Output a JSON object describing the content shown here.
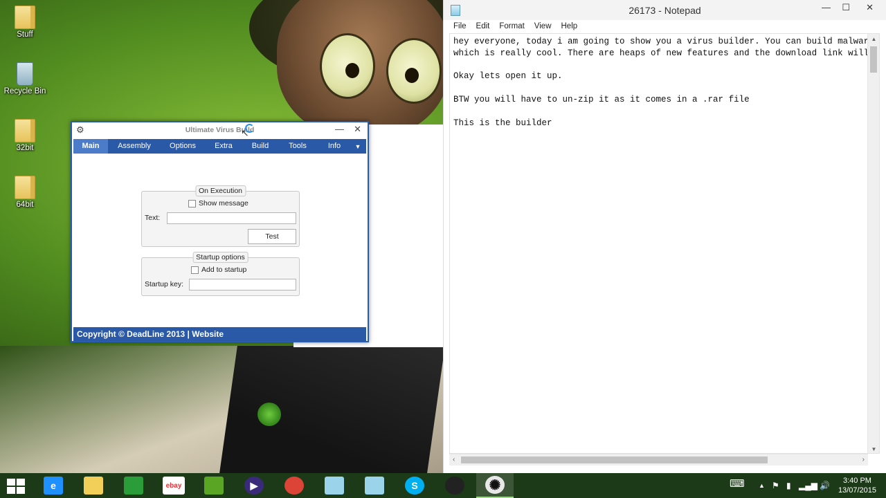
{
  "desktop": {
    "icons": [
      {
        "label": "Stuff"
      },
      {
        "label": "Recycle Bin"
      },
      {
        "label": "32bit"
      },
      {
        "label": "64bit"
      }
    ]
  },
  "builder": {
    "title": "Ultimate Virus Build",
    "menu": [
      "Main",
      "Assembly",
      "Options",
      "Extra",
      "Build",
      "Tools",
      "Info"
    ],
    "active_menu": "Main",
    "on_execution": {
      "legend": "On Execution",
      "show_message_label": "Show message",
      "show_message_checked": false,
      "text_label": "Text:",
      "text_value": "",
      "test_button": "Test"
    },
    "startup_options": {
      "legend": "Startup options",
      "add_to_startup_label": "Add to startup",
      "add_to_startup_checked": false,
      "startup_key_label": "Startup key:",
      "startup_key_value": ""
    },
    "footer": "Copyright © DeadLine 2013 | Website"
  },
  "notepad": {
    "title": "26173 - Notepad",
    "menu": [
      "File",
      "Edit",
      "Format",
      "View",
      "Help"
    ],
    "lines": [
      "hey everyone, today i am going to show you a virus builder. You can build malwar",
      "which is really cool. There are heaps of new features and the download link will",
      "",
      "Okay lets open it up.",
      "",
      "BTW you will have to un-zip it as it comes in a .rar file",
      "",
      "This is the builder"
    ]
  },
  "taskbar": {
    "apps": [
      {
        "name": "internet-explorer",
        "glyph": "e",
        "color": "#1e90ff"
      },
      {
        "name": "file-explorer",
        "glyph": "",
        "color": "#f2cf59"
      },
      {
        "name": "store",
        "glyph": "",
        "color": "#2a9d3a"
      },
      {
        "name": "ebay",
        "glyph": "ebay",
        "color": "#ffffff"
      },
      {
        "name": "evernote",
        "glyph": "",
        "color": "#5ba525"
      },
      {
        "name": "media-player",
        "glyph": "▶",
        "color": "#3a2a7a"
      },
      {
        "name": "chrome",
        "glyph": "",
        "color": "#db4437"
      },
      {
        "name": "notepad",
        "glyph": "",
        "color": "#9ad3ea"
      },
      {
        "name": "notepad-2",
        "glyph": "",
        "color": "#9ad3ea"
      },
      {
        "name": "skype",
        "glyph": "S",
        "color": "#00aff0"
      },
      {
        "name": "obs",
        "glyph": "",
        "color": "#222222"
      },
      {
        "name": "virus-builder",
        "glyph": "✺",
        "color": "#e8e8e8"
      }
    ],
    "active_app": "virus-builder",
    "clock_time": "3:40 PM",
    "clock_date": "13/07/2015"
  }
}
